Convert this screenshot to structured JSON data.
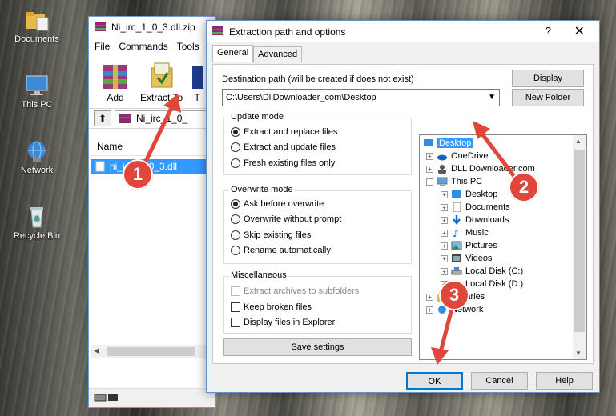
{
  "desktop": {
    "icons": [
      {
        "label": "Documents",
        "icon": "folder-icon"
      },
      {
        "label": "This PC",
        "icon": "computer-icon"
      },
      {
        "label": "Network",
        "icon": "network-icon"
      },
      {
        "label": "Recycle Bin",
        "icon": "recycle-bin-icon"
      }
    ]
  },
  "winrar": {
    "title": "Ni_irc_1_0_3.dll.zip",
    "menu": [
      "File",
      "Commands",
      "Tools"
    ],
    "tools": [
      {
        "label": "Add",
        "icon": "add-archive-icon"
      },
      {
        "label": "Extract To",
        "icon": "extract-to-icon"
      },
      {
        "label": "T",
        "icon": "test-icon"
      }
    ],
    "path": "Ni_irc_1_0_",
    "column_name": "Name",
    "file": "ni_irc_1_0_3.dll"
  },
  "dialog": {
    "title": "Extraction path and options",
    "help": "?",
    "close": "✕",
    "tabs": [
      "General",
      "Advanced"
    ],
    "dest_label": "Destination path (will be created if does not exist)",
    "dest_value": "C:\\Users\\DllDownloader_com\\Desktop",
    "display_btn": "Display",
    "new_folder_btn": "New Folder",
    "update_mode": {
      "title": "Update mode",
      "options": [
        "Extract and replace files",
        "Extract and update files",
        "Fresh existing files only"
      ],
      "selected": 0
    },
    "overwrite_mode": {
      "title": "Overwrite mode",
      "options": [
        "Ask before overwrite",
        "Overwrite without prompt",
        "Skip existing files",
        "Rename automatically"
      ],
      "selected": 0
    },
    "misc": {
      "title": "Miscellaneous",
      "options": [
        "Extract archives to subfolders",
        "Keep broken files",
        "Display files in Explorer"
      ]
    },
    "save_btn": "Save settings",
    "tree": [
      {
        "label": "Desktop",
        "icon": "desktop-icon",
        "level": 0,
        "expander": "",
        "selected": true
      },
      {
        "label": "OneDrive",
        "icon": "onedrive-icon",
        "level": 1,
        "expander": "+"
      },
      {
        "label": "DLL Downloader.com",
        "icon": "user-icon",
        "level": 1,
        "expander": "+"
      },
      {
        "label": "This PC",
        "icon": "computer-icon",
        "level": 1,
        "expander": "−"
      },
      {
        "label": "Desktop",
        "icon": "desktop-icon",
        "level": 2,
        "expander": "+"
      },
      {
        "label": "Documents",
        "icon": "documents-icon",
        "level": 2,
        "expander": "+"
      },
      {
        "label": "Downloads",
        "icon": "downloads-icon",
        "level": 2,
        "expander": "+"
      },
      {
        "label": "Music",
        "icon": "music-icon",
        "level": 2,
        "expander": "+"
      },
      {
        "label": "Pictures",
        "icon": "pictures-icon",
        "level": 2,
        "expander": "+"
      },
      {
        "label": "Videos",
        "icon": "videos-icon",
        "level": 2,
        "expander": "+"
      },
      {
        "label": "Local Disk (C:)",
        "icon": "drive-icon",
        "level": 2,
        "expander": "+"
      },
      {
        "label": "Local Disk (D:)",
        "icon": "drive-icon",
        "level": 2,
        "expander": "+"
      },
      {
        "label": "Libraries",
        "icon": "libraries-icon",
        "level": 1,
        "expander": "+"
      },
      {
        "label": "Network",
        "icon": "network-icon",
        "level": 1,
        "expander": "+"
      }
    ],
    "ok_btn": "OK",
    "cancel_btn": "Cancel",
    "help_btn": "Help"
  },
  "annotations": [
    "1",
    "2",
    "3"
  ],
  "colors": {
    "accent": "#e0463a",
    "selection": "#3399ff"
  }
}
